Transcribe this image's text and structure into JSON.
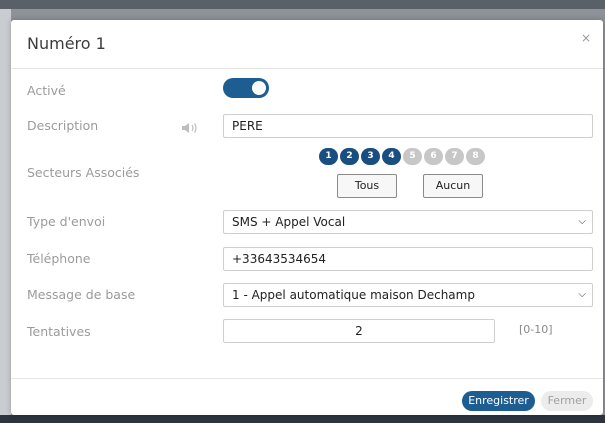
{
  "modal": {
    "title": "Numéro 1",
    "close_icon": "×"
  },
  "form": {
    "active": {
      "label": "Activé",
      "value": true
    },
    "description": {
      "label": "Description",
      "value": "PERE",
      "icon": "speaker-icon"
    },
    "sectors": {
      "label": "Secteurs Associés",
      "items": [
        {
          "label": "1",
          "selected": true
        },
        {
          "label": "2",
          "selected": true
        },
        {
          "label": "3",
          "selected": true
        },
        {
          "label": "4",
          "selected": true
        },
        {
          "label": "5",
          "selected": false
        },
        {
          "label": "6",
          "selected": false
        },
        {
          "label": "7",
          "selected": false
        },
        {
          "label": "8",
          "selected": false
        }
      ],
      "all_button": "Tous",
      "none_button": "Aucun"
    },
    "send_type": {
      "label": "Type d'envoi",
      "value": "SMS + Appel Vocal"
    },
    "phone": {
      "label": "Téléphone",
      "value": "+33643534654"
    },
    "base_message": {
      "label": "Message de base",
      "value": "1 - Appel automatique maison Dechamp"
    },
    "attempts": {
      "label": "Tentatives",
      "value": "2",
      "range_hint": "[0-10]"
    }
  },
  "footer": {
    "save_label": "Enregistrer",
    "close_label": "Fermer"
  },
  "colors": {
    "primary": "#1d5d92",
    "sector_on": "#1a4e80",
    "sector_off": "#c7c7c7"
  }
}
